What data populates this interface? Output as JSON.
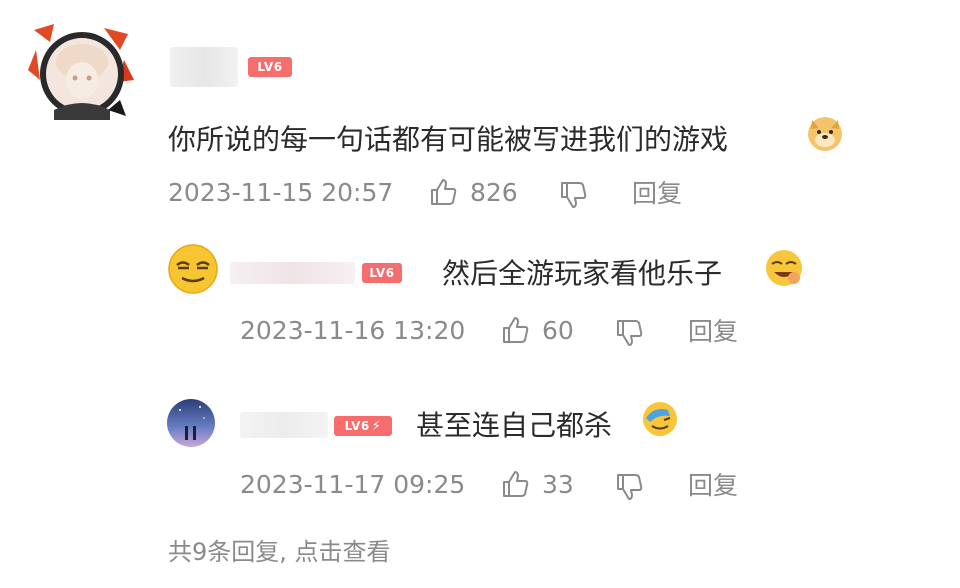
{
  "comments": [
    {
      "level": "LV6",
      "text": "你所说的每一句话都有可能被写进我们的游戏",
      "date": "2023-11-15 20:57",
      "likes": "826",
      "reply_label": "回复"
    },
    {
      "level": "LV6",
      "text": "然后全游玩家看他乐子",
      "date": "2023-11-16 13:20",
      "likes": "60",
      "reply_label": "回复"
    },
    {
      "level": "LV6",
      "text": "甚至连自己都杀",
      "date": "2023-11-17 09:25",
      "likes": "33",
      "reply_label": "回复"
    }
  ],
  "footer": {
    "view_all_label": "共9条回复, 点击查看"
  },
  "colors": {
    "badge": "#f56d6d",
    "meta_text": "#8a8a8a",
    "body_text": "#2b2b2b"
  }
}
